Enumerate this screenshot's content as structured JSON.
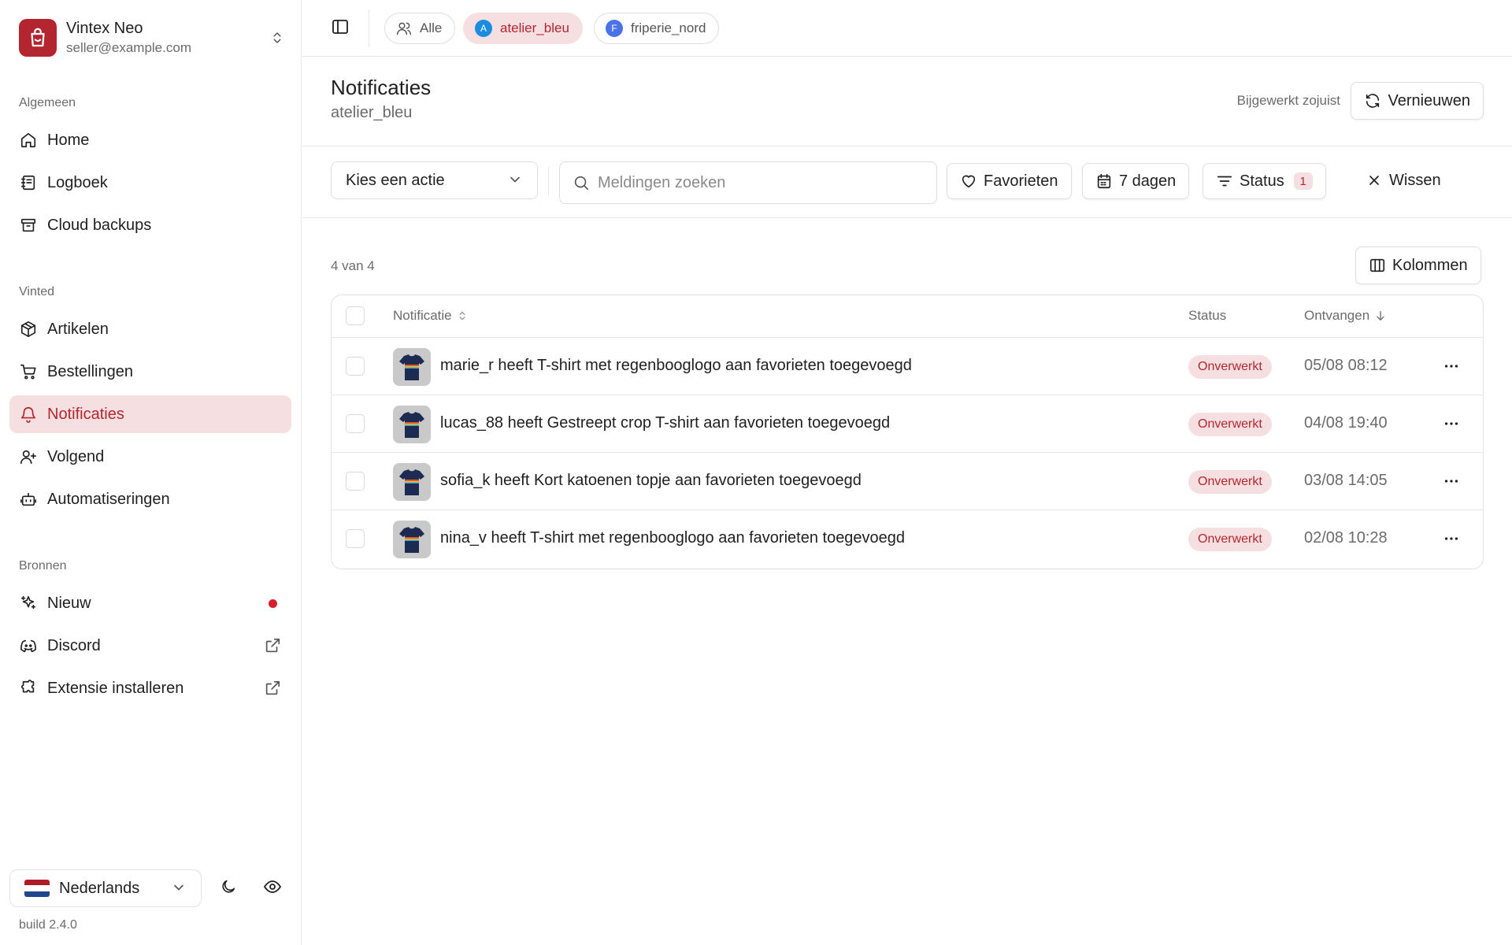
{
  "app": {
    "name": "Vintex Neo",
    "email": "seller@example.com",
    "build": "build 2.4.0",
    "accent": "#b3262f"
  },
  "sidebar": {
    "sections": [
      {
        "label": "Algemeen"
      },
      {
        "label": "Vinted"
      },
      {
        "label": "Bronnen"
      }
    ],
    "items": [
      {
        "label": "Home",
        "icon": "home-icon"
      },
      {
        "label": "Logboek",
        "icon": "logbook-icon"
      },
      {
        "label": "Cloud backups",
        "icon": "archive-icon"
      },
      {
        "label": "Artikelen",
        "icon": "package-icon"
      },
      {
        "label": "Bestellingen",
        "icon": "cart-icon"
      },
      {
        "label": "Notificaties",
        "icon": "bell-icon",
        "active": true
      },
      {
        "label": "Volgend",
        "icon": "user-plus-icon"
      },
      {
        "label": "Automatiseringen",
        "icon": "bot-icon"
      },
      {
        "label": "Nieuw",
        "icon": "sparkles-icon",
        "badge": "red-dot"
      },
      {
        "label": "Discord",
        "icon": "discord-icon",
        "trailing": "external-link-icon"
      },
      {
        "label": "Extensie installeren",
        "icon": "puzzle-icon",
        "trailing": "external-link-icon"
      }
    ],
    "language": "Nederlands"
  },
  "topbar": {
    "accounts": [
      {
        "label": "Alle",
        "icon": "users-icon"
      },
      {
        "label": "atelier_bleu",
        "avatar": "A",
        "avatar_color": "#1a8de0",
        "active": true
      },
      {
        "label": "friperie_nord",
        "avatar": "F",
        "avatar_color": "#4a73e8"
      }
    ]
  },
  "header": {
    "title": "Notificaties",
    "subtitle": "atelier_bleu",
    "updated": "Bijgewerkt zojuist",
    "refresh_label": "Vernieuwen"
  },
  "filters": {
    "action_select": "Kies een actie",
    "search_placeholder": "Meldingen zoeken",
    "favorites_label": "Favorieten",
    "days_label": "7 dagen",
    "status_label": "Status",
    "status_count": "1",
    "clear_label": "Wissen"
  },
  "table": {
    "count": "4 van 4",
    "columns_label": "Kolommen",
    "headers": {
      "notification": "Notificatie",
      "status": "Status",
      "received": "Ontvangen"
    },
    "rows": [
      {
        "text": "marie_r heeft T-shirt met regenbooglogo aan favorieten toegevoegd",
        "status": "Onverwerkt",
        "time": "05/08 08:12"
      },
      {
        "text": "lucas_88 heeft Gestreept crop T-shirt aan favorieten toegevoegd",
        "status": "Onverwerkt",
        "time": "04/08 19:40"
      },
      {
        "text": "sofia_k heeft Kort katoenen topje aan favorieten toegevoegd",
        "status": "Onverwerkt",
        "time": "03/08 14:05"
      },
      {
        "text": "nina_v heeft T-shirt met regenbooglogo aan favorieten toegevoegd",
        "status": "Onverwerkt",
        "time": "02/08 10:28"
      }
    ]
  }
}
